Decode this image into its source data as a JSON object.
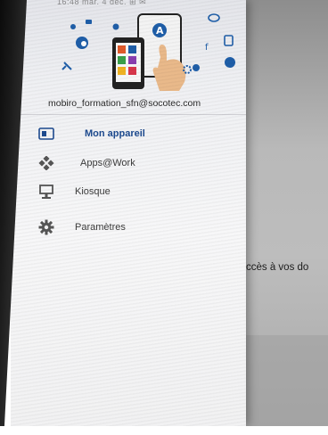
{
  "status_bar": {
    "text": "16:48  mar. 4 déc.  ⊞ ✉"
  },
  "account": {
    "email": "mobiro_formation_sfn@socotec.com"
  },
  "nav": {
    "items": [
      {
        "label": "Mon appareil",
        "icon": "tablet-icon",
        "active": true
      },
      {
        "label": "Apps@Work",
        "icon": "apps-diamond-icon",
        "active": false
      },
      {
        "label": "Kiosque",
        "icon": "kiosk-icon",
        "active": false
      },
      {
        "label": "Paramètres",
        "icon": "gear-icon",
        "active": false
      }
    ]
  },
  "background_app": {
    "visible_text": "ccès à vos do"
  },
  "colors": {
    "accent": "#1d4a8f",
    "header_icon": "#1f5ea8",
    "nav_icon": "#555555",
    "hand": "#e9b98a"
  }
}
